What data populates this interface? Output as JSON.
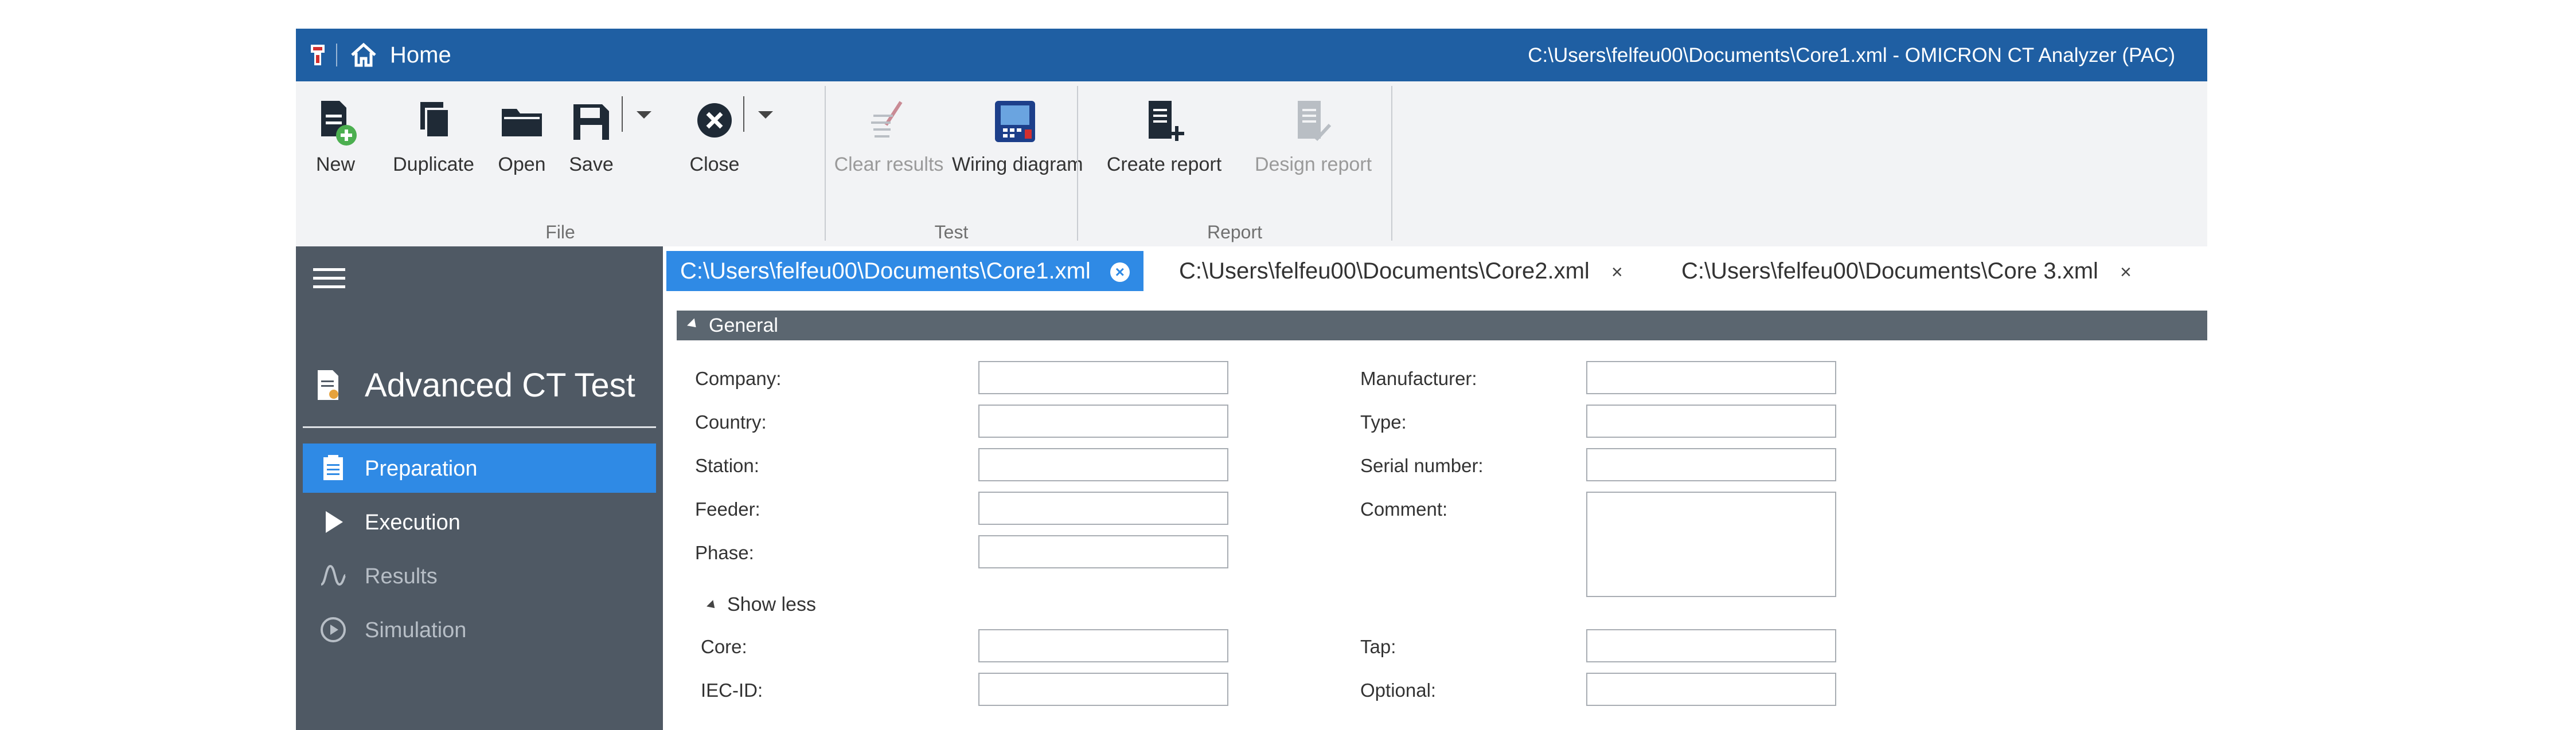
{
  "titlebar": {
    "home_label": "Home",
    "window_title": "C:\\Users\\felfeu00\\Documents\\Core1.xml - OMICRON CT Analyzer (PAC)"
  },
  "ribbon": {
    "groups": [
      {
        "label": "File",
        "buttons": [
          {
            "label": "New",
            "icon": "new-document-icon"
          },
          {
            "label": "Duplicate",
            "icon": "duplicate-icon"
          },
          {
            "label": "Open",
            "icon": "folder-open-icon"
          },
          {
            "label": "Save",
            "icon": "save-icon"
          },
          {
            "label": "Close",
            "icon": "close-circle-icon"
          }
        ]
      },
      {
        "label": "Test",
        "buttons": [
          {
            "label": "Clear results",
            "icon": "broom-icon",
            "disabled": true
          },
          {
            "label": "Wiring diagram",
            "icon": "device-icon"
          }
        ]
      },
      {
        "label": "Report",
        "buttons": [
          {
            "label": "Create report",
            "icon": "report-add-icon"
          },
          {
            "label": "Design report",
            "icon": "report-edit-icon",
            "disabled": true
          }
        ]
      }
    ]
  },
  "sidebar": {
    "title": "Advanced CT Test",
    "items": [
      {
        "label": "Preparation",
        "icon": "clipboard-icon",
        "state": "active"
      },
      {
        "label": "Execution",
        "icon": "play-icon",
        "state": "normal"
      },
      {
        "label": "Results",
        "icon": "wave-icon",
        "state": "muted"
      },
      {
        "label": "Simulation",
        "icon": "simulation-icon",
        "state": "muted"
      }
    ]
  },
  "tabs": [
    {
      "label": "C:\\Users\\felfeu00\\Documents\\Core1.xml",
      "active": true
    },
    {
      "label": "C:\\Users\\felfeu00\\Documents\\Core2.xml",
      "active": false
    },
    {
      "label": "C:\\Users\\felfeu00\\Documents\\Core 3.xml",
      "active": false
    }
  ],
  "tab_close": "×",
  "general": {
    "title": "General",
    "company": "Company:",
    "country": "Country:",
    "station": "Station:",
    "feeder": "Feeder:",
    "phase": "Phase:",
    "manufacturer": "Manufacturer:",
    "type": "Type:",
    "serial_number": "Serial number:",
    "comment": "Comment:",
    "show_less": "Show less",
    "core": "Core:",
    "iec_id": "IEC-ID:",
    "tap": "Tap:",
    "optional": "Optional:"
  },
  "colors": {
    "titlebar": "#1f5fa3",
    "accent": "#2f8ae5",
    "sidebar": "#4f5964",
    "section_bar": "#5b6670"
  }
}
